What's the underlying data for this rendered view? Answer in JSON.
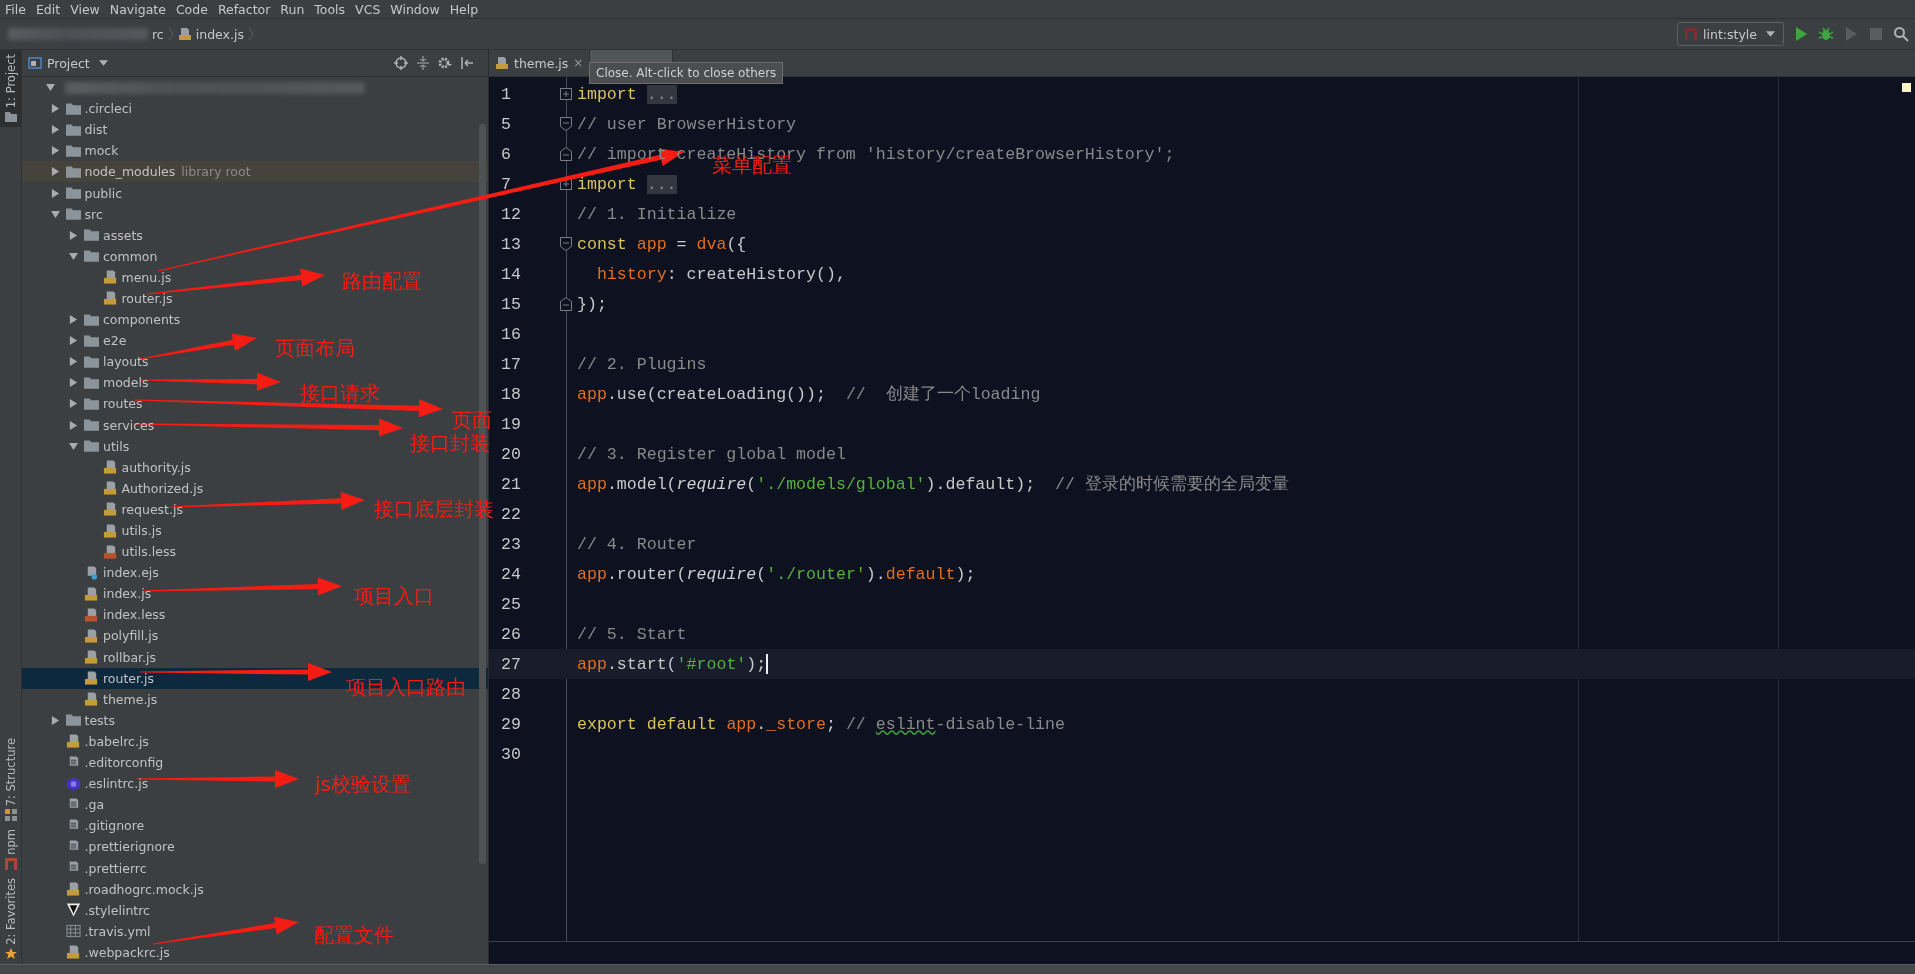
{
  "menu": [
    "File",
    "Edit",
    "View",
    "Navigate",
    "Code",
    "Refactor",
    "Run",
    "Tools",
    "VCS",
    "Window",
    "Help"
  ],
  "breadcrumbs": [
    "rc",
    "index.js"
  ],
  "run_config": {
    "label": "lint:style"
  },
  "tool_tabs": [
    {
      "label": "1: Project",
      "selected": true,
      "kind": "project"
    },
    {
      "label": "7: Structure",
      "selected": false,
      "kind": "structure"
    },
    {
      "label": "npm",
      "selected": false,
      "kind": "npm"
    },
    {
      "label": "2: Favorites",
      "selected": false,
      "kind": "favorites"
    }
  ],
  "project_panel": {
    "title": "Project"
  },
  "tree": {
    "expanded": true,
    "children": [
      {
        "name": ".circleci",
        "kind": "folder",
        "expanded": false,
        "selected": false
      },
      {
        "name": "dist",
        "kind": "folder",
        "expanded": false,
        "selected": false
      },
      {
        "name": "mock",
        "kind": "folder",
        "expanded": false,
        "selected": false
      },
      {
        "name": "node_modules",
        "kind": "folder",
        "expanded": false,
        "selected": false,
        "note": "library root"
      },
      {
        "name": "public",
        "kind": "folder",
        "expanded": false,
        "selected": false
      },
      {
        "name": "src",
        "kind": "folder",
        "expanded": true,
        "selected": false,
        "children": [
          {
            "name": "assets",
            "kind": "folder",
            "expanded": false,
            "selected": false
          },
          {
            "name": "common",
            "kind": "folder",
            "expanded": true,
            "selected": false,
            "children": [
              {
                "name": "menu.js",
                "kind": "js",
                "selected": false
              },
              {
                "name": "router.js",
                "kind": "js",
                "selected": false
              }
            ]
          },
          {
            "name": "components",
            "kind": "folder",
            "expanded": false,
            "selected": false
          },
          {
            "name": "e2e",
            "kind": "folder",
            "expanded": false,
            "selected": false
          },
          {
            "name": "layouts",
            "kind": "folder",
            "expanded": false,
            "selected": false
          },
          {
            "name": "models",
            "kind": "folder",
            "expanded": false,
            "selected": false
          },
          {
            "name": "routes",
            "kind": "folder",
            "expanded": false,
            "selected": false
          },
          {
            "name": "services",
            "kind": "folder",
            "expanded": false,
            "selected": false
          },
          {
            "name": "utils",
            "kind": "folder",
            "expanded": true,
            "selected": false,
            "children": [
              {
                "name": "authority.js",
                "kind": "js",
                "selected": false
              },
              {
                "name": "Authorized.js",
                "kind": "js",
                "selected": false
              },
              {
                "name": "request.js",
                "kind": "js",
                "selected": false
              },
              {
                "name": "utils.js",
                "kind": "js",
                "selected": false
              },
              {
                "name": "utils.less",
                "kind": "less",
                "selected": false
              }
            ]
          },
          {
            "name": "index.ejs",
            "kind": "ejs",
            "selected": false
          },
          {
            "name": "index.js",
            "kind": "js",
            "selected": false
          },
          {
            "name": "index.less",
            "kind": "less",
            "selected": false
          },
          {
            "name": "polyfill.js",
            "kind": "js",
            "selected": false
          },
          {
            "name": "rollbar.js",
            "kind": "js",
            "selected": false
          },
          {
            "name": "router.js",
            "kind": "js",
            "selected": true
          },
          {
            "name": "theme.js",
            "kind": "js",
            "selected": false
          }
        ]
      },
      {
        "name": "tests",
        "kind": "folder",
        "expanded": false,
        "selected": false
      },
      {
        "name": ".babelrc.js",
        "kind": "js",
        "selected": false
      },
      {
        "name": ".editorconfig",
        "kind": "text",
        "selected": false
      },
      {
        "name": ".eslintrc.js",
        "kind": "eslint",
        "selected": false
      },
      {
        "name": ".ga",
        "kind": "text",
        "selected": false
      },
      {
        "name": ".gitignore",
        "kind": "text",
        "selected": false
      },
      {
        "name": ".prettierignore",
        "kind": "text",
        "selected": false
      },
      {
        "name": ".prettierrc",
        "kind": "prettier",
        "selected": false
      },
      {
        "name": ".roadhogrc.mock.js",
        "kind": "js",
        "selected": false
      },
      {
        "name": ".stylelintrc",
        "kind": "stylelint",
        "selected": false
      },
      {
        "name": ".travis.yml",
        "kind": "yaml",
        "selected": false
      },
      {
        "name": ".webpackrc.js",
        "kind": "js",
        "selected": false
      }
    ]
  },
  "editor_tabs": [
    {
      "label": "theme.js",
      "close": "×",
      "selected": false
    },
    {
      "selected": true
    }
  ],
  "tooltip": "Close. Alt-click to close others",
  "code": [
    {
      "number": "1",
      "kind": "folded",
      "current": false,
      "tokens": [
        {
          "text": "import",
          "kind": "keyword"
        },
        {
          "text": "...",
          "kind": "folded"
        }
      ]
    },
    {
      "number": "5",
      "kind": "fold_start",
      "current": false,
      "tokens": [
        {
          "text": "// user BrowserHistory",
          "kind": "comment"
        }
      ]
    },
    {
      "number": "6",
      "kind": "fold_end",
      "current": false,
      "tokens": [
        {
          "text": "// import createHistory from 'history/createBrowserHistory';",
          "kind": "comment"
        }
      ]
    },
    {
      "number": "7",
      "kind": "folded",
      "current": false,
      "tokens": [
        {
          "text": "import",
          "kind": "keyword"
        },
        {
          "text": "...",
          "kind": "folded"
        }
      ]
    },
    {
      "number": "12",
      "kind": "plain",
      "current": false,
      "tokens": [
        {
          "text": "// 1. Initialize",
          "kind": "comment"
        }
      ]
    },
    {
      "number": "13",
      "kind": "fold_start",
      "current": false,
      "tokens": [
        {
          "text": "const",
          "kind": "keyword"
        },
        {
          "text": " app",
          "kind": "var"
        },
        {
          "text": " = ",
          "kind": "plain"
        },
        {
          "text": "dva",
          "kind": "var"
        },
        {
          "text": "({",
          "kind": "plain"
        }
      ]
    },
    {
      "number": "14",
      "kind": "plain",
      "current": false,
      "indented": true,
      "tokens": [
        {
          "text": "history",
          "kind": "var"
        },
        {
          "text": ": createHistory(),",
          "kind": "plain"
        }
      ]
    },
    {
      "number": "15",
      "kind": "fold_end",
      "current": false,
      "tokens": [
        {
          "text": "});",
          "kind": "plain"
        }
      ]
    },
    {
      "number": "16",
      "kind": "plain",
      "current": false
    },
    {
      "number": "17",
      "kind": "plain",
      "current": false,
      "tokens": [
        {
          "text": "// 2. Plugins",
          "kind": "comment"
        }
      ]
    },
    {
      "number": "18",
      "kind": "plain",
      "current": false,
      "tokens": [
        {
          "text": "app",
          "kind": "var"
        },
        {
          "text": ".use(createLoading());  ",
          "kind": "plain"
        },
        {
          "text": "//  创建了一个loading",
          "kind": "comment"
        }
      ]
    },
    {
      "number": "19",
      "kind": "plain",
      "current": false
    },
    {
      "number": "20",
      "kind": "plain",
      "current": false,
      "tokens": [
        {
          "text": "// 3. Register global model",
          "kind": "comment"
        }
      ]
    },
    {
      "number": "21",
      "kind": "plain",
      "current": false,
      "tokens": [
        {
          "text": "app",
          "kind": "var"
        },
        {
          "text": ".model(",
          "kind": "plain"
        },
        {
          "text": "require",
          "kind": "italic"
        },
        {
          "text": "(",
          "kind": "plain"
        },
        {
          "text": "'./models/global'",
          "kind": "string"
        },
        {
          "text": ").default);  ",
          "kind": "plain"
        },
        {
          "text": "// 登录的时候需要的全局变量",
          "kind": "comment"
        }
      ]
    },
    {
      "number": "22",
      "kind": "plain",
      "current": false
    },
    {
      "number": "23",
      "kind": "plain",
      "current": false,
      "tokens": [
        {
          "text": "// 4. Router",
          "kind": "comment"
        }
      ]
    },
    {
      "number": "24",
      "kind": "plain",
      "current": false,
      "tokens": [
        {
          "text": "app",
          "kind": "var"
        },
        {
          "text": ".router(",
          "kind": "plain"
        },
        {
          "text": "require",
          "kind": "italic"
        },
        {
          "text": "(",
          "kind": "plain"
        },
        {
          "text": "'./router'",
          "kind": "string"
        },
        {
          "text": ").",
          "kind": "plain"
        },
        {
          "text": "default",
          "kind": "var"
        },
        {
          "text": ");",
          "kind": "plain"
        }
      ]
    },
    {
      "number": "25",
      "kind": "plain",
      "current": false
    },
    {
      "number": "26",
      "kind": "plain",
      "current": false,
      "tokens": [
        {
          "text": "// 5. Start",
          "kind": "comment"
        }
      ]
    },
    {
      "number": "27",
      "kind": "plain",
      "current": true,
      "tokens": [
        {
          "text": "app",
          "kind": "var"
        },
        {
          "text": ".start(",
          "kind": "plain"
        },
        {
          "text": "'#root'",
          "kind": "string"
        },
        {
          "text": ");",
          "kind": "plain"
        }
      ]
    },
    {
      "number": "28",
      "kind": "plain",
      "current": false
    },
    {
      "number": "29",
      "kind": "plain",
      "current": false,
      "tokens": [
        {
          "text": "export default",
          "kind": "keyword"
        },
        {
          "text": " app",
          "kind": "var"
        },
        {
          "text": ".",
          "kind": "plain"
        },
        {
          "text": "_store",
          "kind": "var"
        },
        {
          "text": "; ",
          "kind": "plain"
        },
        {
          "text": "// ",
          "kind": "comment"
        },
        {
          "text": "eslint",
          "kind": "typo"
        },
        {
          "text": "-disable-line",
          "kind": "comment"
        }
      ]
    },
    {
      "number": "30",
      "kind": "plain",
      "current": false
    }
  ],
  "annotations": [
    {
      "text": "菜单配置"
    },
    {
      "text": "路由配置"
    },
    {
      "text": "页面布局"
    },
    {
      "text": "接口请求"
    },
    {
      "text": "页面"
    },
    {
      "text": "接口封装"
    },
    {
      "text": "接口底层封装"
    },
    {
      "text": "项目入口"
    },
    {
      "text": "项目入口路由"
    },
    {
      "text": "js校验设置"
    },
    {
      "text": "配置文件"
    }
  ]
}
